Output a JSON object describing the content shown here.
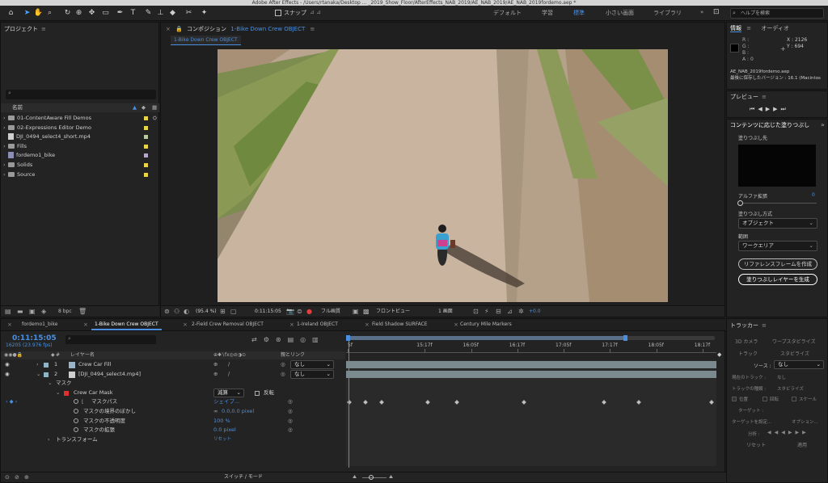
{
  "app": {
    "title": "Adobe After Effects - /Users/rtanaka/Desktop ... _2019_Show_Floor/AfterEffects_NAB_2019/AE_NAB_2019/AE_NAB_2019fordemo.aep *"
  },
  "toolbar": {
    "snap_label": "スナップ",
    "workspaces": [
      "デフォルト",
      "学習",
      "標準",
      "小さい画面",
      "ライブラリ"
    ],
    "active_workspace": "標準",
    "more": "»",
    "search_placeholder": "ヘルプを検索"
  },
  "project": {
    "title": "プロジェクト",
    "column_name": "名前",
    "bpc": "8 bpc",
    "items": [
      {
        "name": "01-ContentAware Fill Demos",
        "type": "folder",
        "color": "#e8d545"
      },
      {
        "name": "02-Expressions Editor Demo",
        "type": "folder",
        "color": "#e8d545"
      },
      {
        "name": "DJI_0494_select4_short.mp4",
        "type": "file",
        "color": "#b7c9a3"
      },
      {
        "name": "Fills",
        "type": "folder",
        "color": "#e8d545"
      },
      {
        "name": "fordemo1_bike",
        "type": "comp",
        "color": "#b7a7c8"
      },
      {
        "name": "Solids",
        "type": "folder",
        "color": "#e8d545"
      },
      {
        "name": "Source",
        "type": "folder",
        "color": "#e8d545"
      }
    ]
  },
  "composition": {
    "panel_title": "コンポジション",
    "comp_name": "1-Bike Down Crew OBJECT",
    "subtab": "1-Bike Down Crew OBJECT",
    "footer": {
      "zoom": "(95.4 %)",
      "timecode": "0:11:15:05",
      "resolution": "フル画質",
      "view": "フロントビュー",
      "views": "1 画面",
      "exposure": "+0.0"
    }
  },
  "info": {
    "tabs": [
      "情報",
      "オーディオ"
    ],
    "r": "R :",
    "g": "G :",
    "b": "B :",
    "a": "A : 0",
    "x": "X : 2126",
    "y": "Y : 694",
    "file": "AE_NAB_2019fordemo.aep",
    "saved": "最後に保存したバージョン : 16.1 (Macintos"
  },
  "preview": {
    "title": "プレビュー"
  },
  "caf": {
    "title": "コンテンツに応じた塗りつぶし",
    "fill_target": "塗りつぶし先",
    "alpha_label": "アルファ拡張",
    "alpha_value": "0",
    "method_label": "塗りつぶし方式",
    "method_value": "オブジェクト",
    "range_label": "範囲",
    "range_value": "ワークエリア",
    "btn_reference": "リファレンスフレームを作成",
    "btn_generate": "塗りつぶしレイヤーを生成"
  },
  "tracker": {
    "title": "トラッカー",
    "btn_3d": "3D カメラ",
    "btn_warp": "ワープスタビライズ",
    "btn_track": "トラック",
    "btn_stabilize": "スタビライズ",
    "source_label": "ソース :",
    "source_value": "なし",
    "current_track": "現在のトラック :",
    "current_track_value": "なし",
    "track_type": "トラックの種類 :",
    "track_type_value": "スタビライズ",
    "opt_position": "位置",
    "opt_rotation": "回転",
    "opt_scale": "スケール",
    "target_label": "ターゲット :",
    "target_set": "ターゲットを設定...",
    "options": "オプション...",
    "analyze": "分析 :",
    "reset": "リセット",
    "apply": "適用"
  },
  "timeline": {
    "tabs": [
      {
        "label": "fordemo1_bike",
        "active": false
      },
      {
        "label": "1-Bike Down Crew OBJECT",
        "active": true
      },
      {
        "label": "2-Field Crew Removal OBJECT",
        "active": false
      },
      {
        "label": "1-Ireland OBJECT",
        "active": false
      },
      {
        "label": "Field Shadow SURFACE",
        "active": false
      },
      {
        "label": "Century Mile Markers",
        "active": false
      }
    ],
    "timecode": "0:11:15:05",
    "fps": "16205 (23.976 fps)",
    "col_number": "#",
    "col_layer_name": "レイヤー名",
    "col_parent": "親とリンク",
    "ruler": [
      "5f",
      "15:17f",
      "16:05f",
      "16:17f",
      "17:05f",
      "17:17f",
      "18:05f",
      "18:17f"
    ],
    "layers": [
      {
        "num": "1",
        "name": "Crew Car Fill",
        "parent": "なし",
        "color": "#8fb3c9"
      },
      {
        "num": "2",
        "name": "[DJI_0494_select4.mp4]",
        "parent": "なし",
        "color": "#8fb3c9"
      }
    ],
    "masks_label": "マスク",
    "mask_name": "Crew Car Mask",
    "mask_mode": "減算",
    "mask_invert": "反転",
    "mask_color": "#e03030",
    "props": [
      {
        "label": "マスクパス",
        "value": "シェイプ..."
      },
      {
        "label": "マスクの境界のぼかし",
        "value": "0.0,0.0 pixel"
      },
      {
        "label": "マスクの不透明度",
        "value": "100 %"
      },
      {
        "label": "マスクの拡張",
        "value": "0.0 pixel"
      }
    ],
    "transform_label": "トランスフォーム",
    "transform_value": "リセット",
    "switch_mode": "スイッチ / モード",
    "keyframes": [
      0,
      0.045,
      0.088,
      0.215,
      0.295,
      0.48,
      0.7,
      0.795,
      0.995
    ]
  }
}
